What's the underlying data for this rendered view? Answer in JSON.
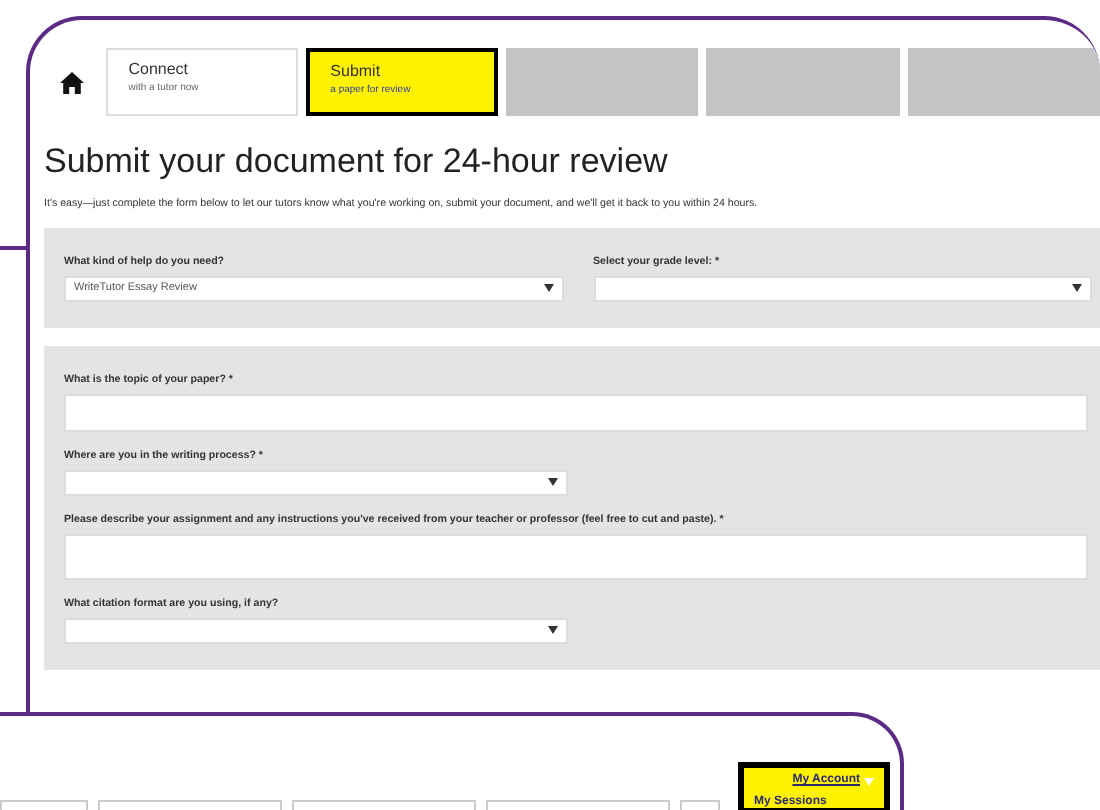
{
  "submit_page": {
    "tabs": [
      {
        "kind": "home",
        "selected": false
      },
      {
        "kind": "text",
        "title": "Connect",
        "subtitle": "with a tutor now",
        "selected": false
      },
      {
        "kind": "text",
        "title": "Submit",
        "subtitle": "a paper for review",
        "selected": true
      },
      {
        "kind": "blank",
        "selected": false
      },
      {
        "kind": "blank",
        "selected": false
      },
      {
        "kind": "blank",
        "selected": false
      }
    ],
    "heading": "Submit your document for 24-hour review",
    "intro": "It's easy—just complete the form below to let our tutors know what you're working on, submit your document, and we'll get it back to you within 24 hours.",
    "sections": [
      {
        "kind": "row",
        "fields": [
          {
            "kind": "select",
            "label": "What kind of help do you need?",
            "value": "WriteTutor Essay Review"
          },
          {
            "kind": "select",
            "label": "Select your grade level: *"
          }
        ]
      },
      {
        "kind": "column",
        "fields": [
          {
            "kind": "text",
            "label": "What is the topic of your paper? *"
          },
          {
            "kind": "select",
            "label": "Where are you in the writing process? *"
          },
          {
            "kind": "textarea",
            "label": "Please describe your assignment and any instructions you've received from your teacher or professor (feel free to cut and paste). *"
          },
          {
            "kind": "select",
            "label": "What citation format are you using, if any?"
          }
        ]
      }
    ]
  },
  "account_page": {
    "menu": {
      "label": "My Account",
      "items": [
        "My Sessions"
      ]
    }
  }
}
